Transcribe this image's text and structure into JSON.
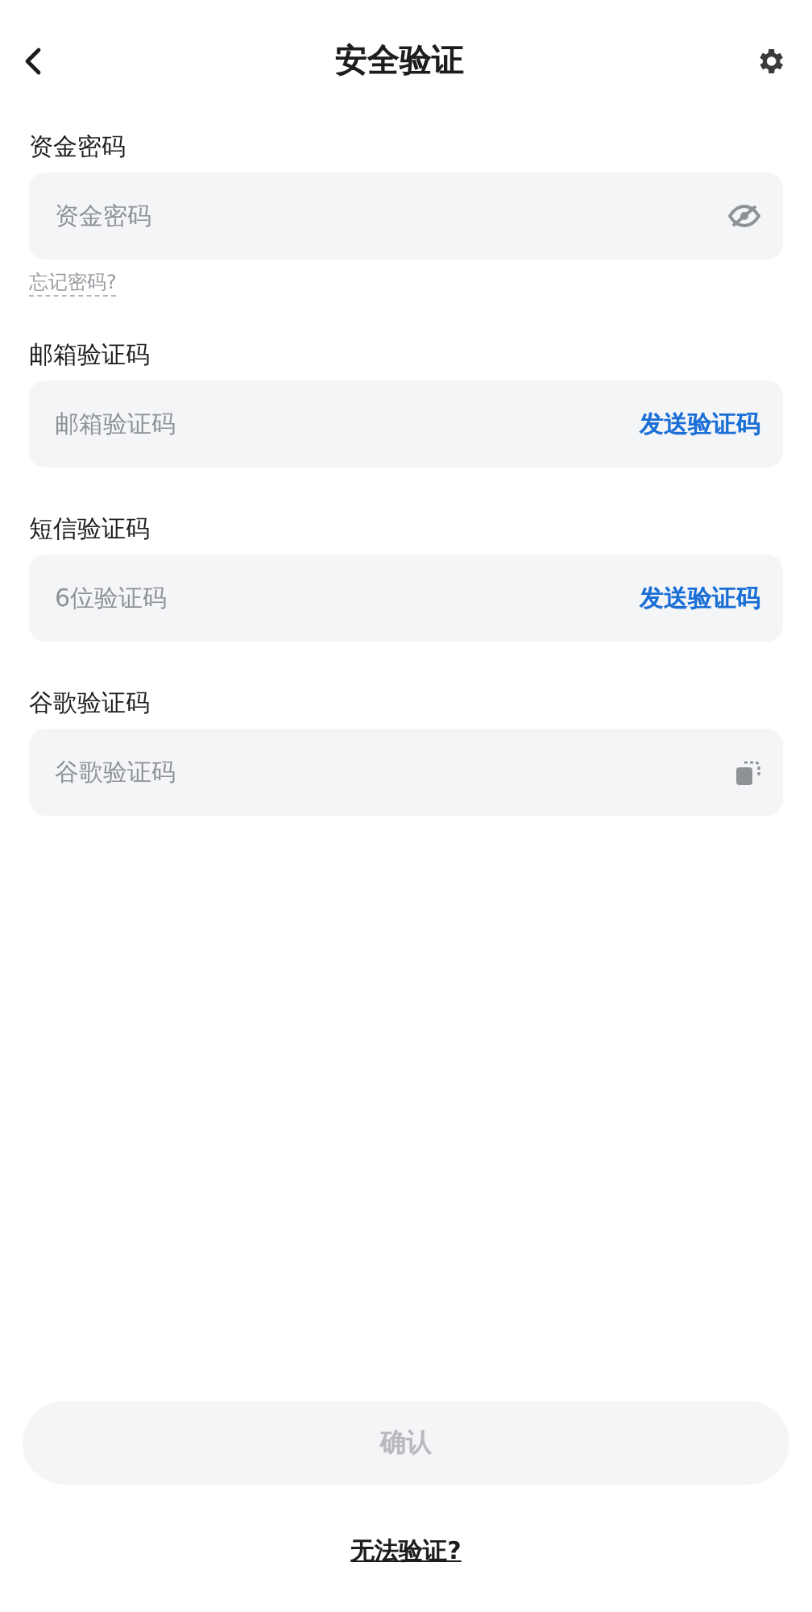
{
  "header": {
    "title": "安全验证"
  },
  "fields": [
    {
      "kind": "password",
      "label": "资金密码",
      "placeholder": "资金密码",
      "link": "忘记密码?"
    },
    {
      "kind": "send",
      "label": "邮箱验证码",
      "placeholder": "邮箱验证码",
      "action": "发送验证码"
    },
    {
      "kind": "send",
      "label": "短信验证码",
      "placeholder": "6位验证码",
      "action": "发送验证码"
    },
    {
      "kind": "paste",
      "label": "谷歌验证码",
      "placeholder": "谷歌验证码"
    }
  ],
  "confirm": {
    "label": "确认",
    "disabled": true
  },
  "help_link": "无法验证?"
}
